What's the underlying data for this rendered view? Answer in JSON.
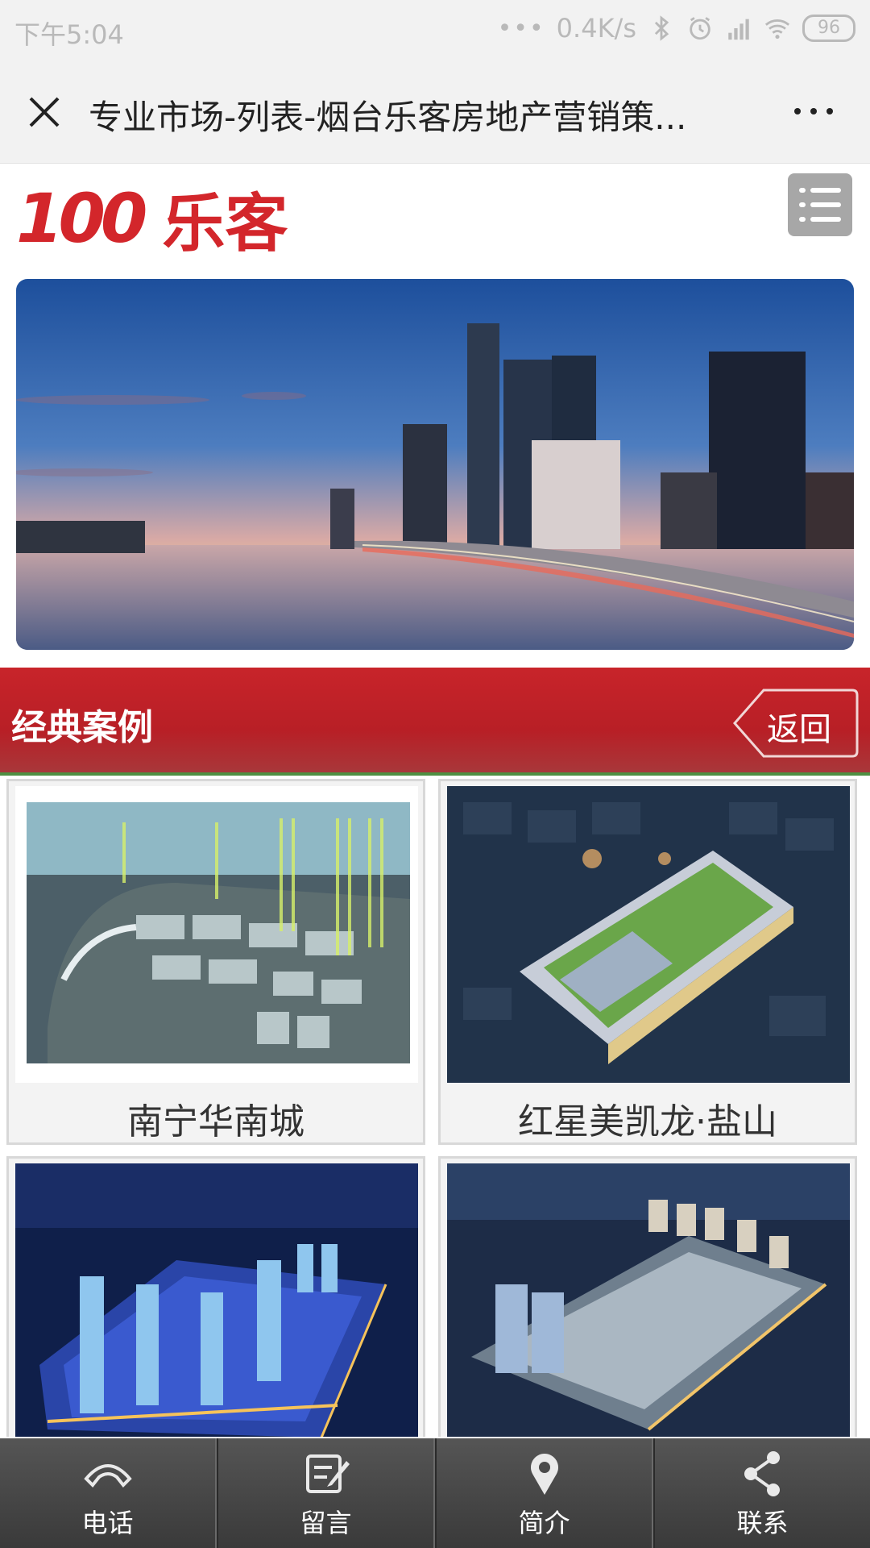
{
  "status_bar": {
    "time": "下午5:04",
    "network_speed": "0.4K/s",
    "battery": "96"
  },
  "title_bar": {
    "title": "专业市场-列表-烟台乐客房地产营销策..."
  },
  "header": {
    "logo_number": "100",
    "logo_text": "乐客"
  },
  "section": {
    "title": "经典案例",
    "back_label": "返回"
  },
  "cases": [
    {
      "name": "南宁华南城"
    },
    {
      "name": "红星美凯龙·盐山"
    },
    {
      "name": ""
    },
    {
      "name": ""
    }
  ],
  "tabbar": {
    "items": [
      {
        "label": "电话",
        "icon": "phone-icon"
      },
      {
        "label": "留言",
        "icon": "message-icon"
      },
      {
        "label": "简介",
        "icon": "location-pin-icon"
      },
      {
        "label": "联系",
        "icon": "share-icon"
      }
    ]
  },
  "colors": {
    "brand_red": "#d3262b",
    "section_red": "#c8242a",
    "tabbar": "#444444"
  }
}
